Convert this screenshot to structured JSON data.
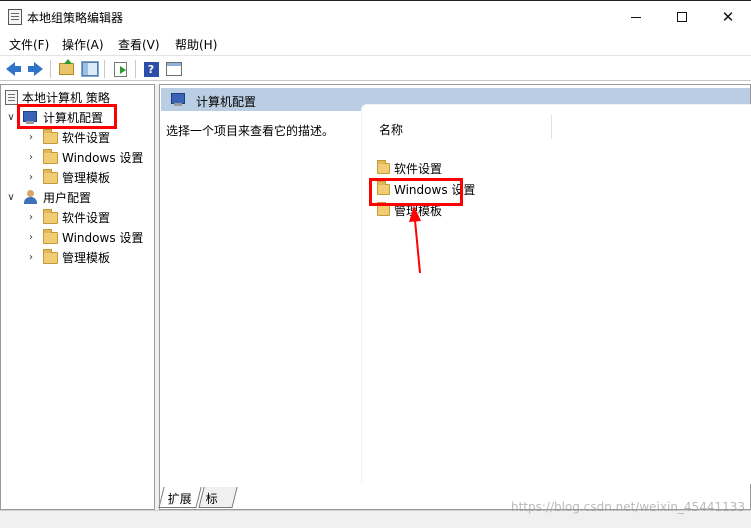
{
  "window": {
    "title": "本地组策略编辑器",
    "minimize_glyph": "—",
    "maximize_glyph": "☐",
    "close_glyph": "✕"
  },
  "menu": [
    "文件(F)",
    "操作(A)",
    "查看(V)",
    "帮助(H)"
  ],
  "toolbar_icons": [
    "back-arrow-icon",
    "forward-arrow-icon",
    "up-folder-icon",
    "show-hide-tree-icon",
    "export-list-icon",
    "help-icon",
    "properties-icon"
  ],
  "tree": {
    "root": "本地计算机 策略",
    "computer_config": {
      "label": "计算机配置",
      "expanded": true,
      "children": [
        "软件设置",
        "Windows 设置",
        "管理模板"
      ]
    },
    "user_config": {
      "label": "用户配置",
      "expanded": true,
      "children": [
        "软件设置",
        "Windows 设置",
        "管理模板"
      ]
    }
  },
  "right_pane": {
    "header": "计算机配置",
    "description": "选择一个项目来查看它的描述。",
    "column_name": "名称",
    "items": [
      "软件设置",
      "Windows 设置",
      "管理模板"
    ]
  },
  "tabs": [
    "扩展",
    "标准"
  ],
  "watermark": "https://blog.csdn.net/weixin_45441133",
  "annotation_color": "#ff0000",
  "header_color": "#b9cde3"
}
